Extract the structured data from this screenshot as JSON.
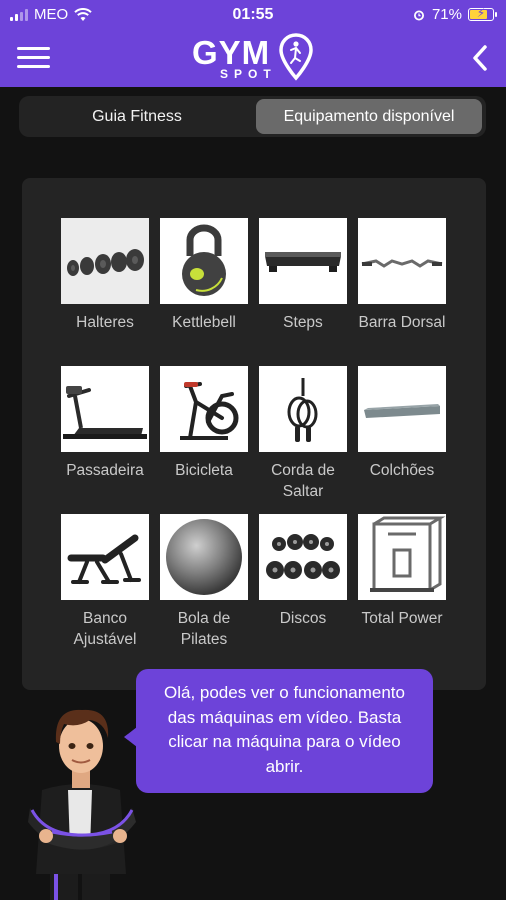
{
  "status_bar": {
    "carrier": "MEO",
    "time": "01:55",
    "battery": "71%",
    "battery_level": 0.71,
    "icons": [
      "signal-icon",
      "wifi-icon",
      "alarm-icon",
      "battery-charging-icon"
    ]
  },
  "header": {
    "logo_main": "GYM",
    "logo_sub": "SPOT",
    "icons": [
      "hamburger-menu-icon",
      "location-pin-icon",
      "chevron-left-icon"
    ]
  },
  "tabs": [
    {
      "label": "Guia Fitness",
      "selected": false
    },
    {
      "label": "Equipamento disponível",
      "selected": true
    }
  ],
  "equipment": [
    {
      "label": "Halteres",
      "icon": "dumbbells"
    },
    {
      "label": "Kettlebell",
      "icon": "kettlebell"
    },
    {
      "label": "Steps",
      "icon": "step-platform"
    },
    {
      "label": "Barra Dorsal",
      "icon": "curl-bar"
    },
    {
      "label": "Passadeira",
      "icon": "treadmill"
    },
    {
      "label": "Bicicleta",
      "icon": "spin-bike"
    },
    {
      "label": "Corda de Saltar",
      "icon": "jump-rope"
    },
    {
      "label": "Colchões",
      "icon": "exercise-mat"
    },
    {
      "label": "Banco Ajustável",
      "icon": "adjustable-bench"
    },
    {
      "label": "Bola de Pilates",
      "icon": "pilates-ball"
    },
    {
      "label": "Discos",
      "icon": "weight-plates"
    },
    {
      "label": "Total Power",
      "icon": "power-rack"
    }
  ],
  "assistant": {
    "message": "Olá, podes ver o funcionamento das máquinas em vídeo. Basta clicar na máquina para o vídeo abrir."
  },
  "colors": {
    "brand": "#6d43d9",
    "background": "#121212",
    "card": "#242424"
  }
}
